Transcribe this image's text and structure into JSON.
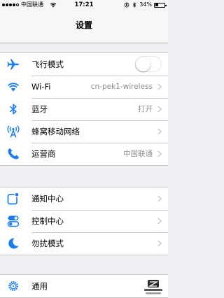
{
  "status_bar": {
    "carrier": "中国联通",
    "time": "17:21",
    "battery_percent": "34%",
    "battery_level": 0.34,
    "signal_bars_filled": 4,
    "signal_bars_total": 5
  },
  "nav": {
    "title": "设置"
  },
  "groups": [
    {
      "rows": [
        {
          "label": "飞行模式",
          "icon": "airplane-icon",
          "control": "toggle",
          "toggle_on": false
        },
        {
          "label": "Wi-Fi",
          "value": "cn-pek1-wireless",
          "icon": "wifi-icon"
        },
        {
          "label": "蓝牙",
          "value": "打开",
          "icon": "bluetooth-icon"
        },
        {
          "label": "蜂窝移动网络",
          "icon": "cellular-icon"
        },
        {
          "label": "运营商",
          "value": "中国联通",
          "icon": "phone-icon"
        }
      ]
    },
    {
      "rows": [
        {
          "label": "通知中心",
          "icon": "notification-center-icon"
        },
        {
          "label": "控制中心",
          "icon": "control-center-icon"
        },
        {
          "label": "勿扰模式",
          "icon": "moon-icon"
        }
      ]
    },
    {
      "rows": [
        {
          "label": "通用",
          "icon": "gear-icon"
        }
      ]
    }
  ],
  "colors": {
    "icon_blue": "#1a7cf4",
    "background": "#efeff4",
    "secondary_text": "#8e8e93",
    "chevron": "#c7c7cc",
    "separator": "#c8c7cc"
  },
  "watermark_icon": "zol-watermark-icon"
}
